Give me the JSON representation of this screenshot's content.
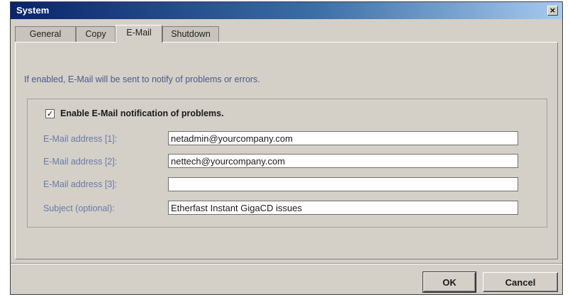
{
  "window": {
    "title": "System",
    "close_glyph": "×"
  },
  "tabs": [
    {
      "label": "General",
      "active": false
    },
    {
      "label": "Copy",
      "active": false
    },
    {
      "label": "E-Mail",
      "active": true
    },
    {
      "label": "Shutdown",
      "active": false
    }
  ],
  "panel": {
    "info_text": "If enabled, E-Mail will be sent to notify of problems or errors.",
    "enable_checkbox": {
      "label": "Enable E-Mail notification of problems.",
      "checked": true,
      "check_glyph": "✓"
    },
    "fields": [
      {
        "label": "E-Mail address [1]:",
        "value": "netadmin@yourcompany.com"
      },
      {
        "label": "E-Mail address [2]:",
        "value": "nettech@yourcompany.com"
      },
      {
        "label": "E-Mail address [3]:",
        "value": ""
      },
      {
        "label": "Subject (optional):",
        "value": "Etherfast Instant GigaCD issues"
      }
    ]
  },
  "buttons": {
    "ok": "OK",
    "cancel": "Cancel"
  }
}
